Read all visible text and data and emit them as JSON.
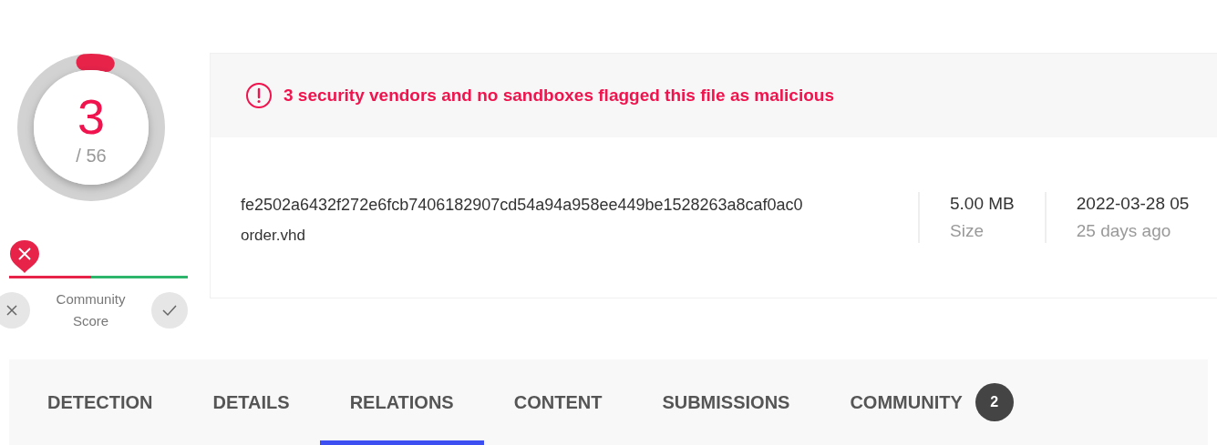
{
  "detection_score": {
    "count": "3",
    "total": "/ 56",
    "level": 0.054
  },
  "community_score": {
    "label": "Community Score"
  },
  "alert": {
    "message": "3 security vendors and no sandboxes flagged this file as malicious"
  },
  "file": {
    "hash": "fe2502a6432f272e6fcb7406182907cd54a94a958ee449be1528263a8caf0ac0",
    "name": "order.vhd"
  },
  "properties": [
    {
      "value": "5.00 MB",
      "label": "Size"
    },
    {
      "value": "2022-03-28 05",
      "label": "25 days ago"
    }
  ],
  "tabs": [
    {
      "label": "DETECTION",
      "selected": false
    },
    {
      "label": "DETAILS",
      "selected": false
    },
    {
      "label": "RELATIONS",
      "selected": true
    },
    {
      "label": "CONTENT",
      "selected": false
    },
    {
      "label": "SUBMISSIONS",
      "selected": false
    },
    {
      "label": "COMMUNITY",
      "selected": false,
      "badge": "2"
    }
  ]
}
